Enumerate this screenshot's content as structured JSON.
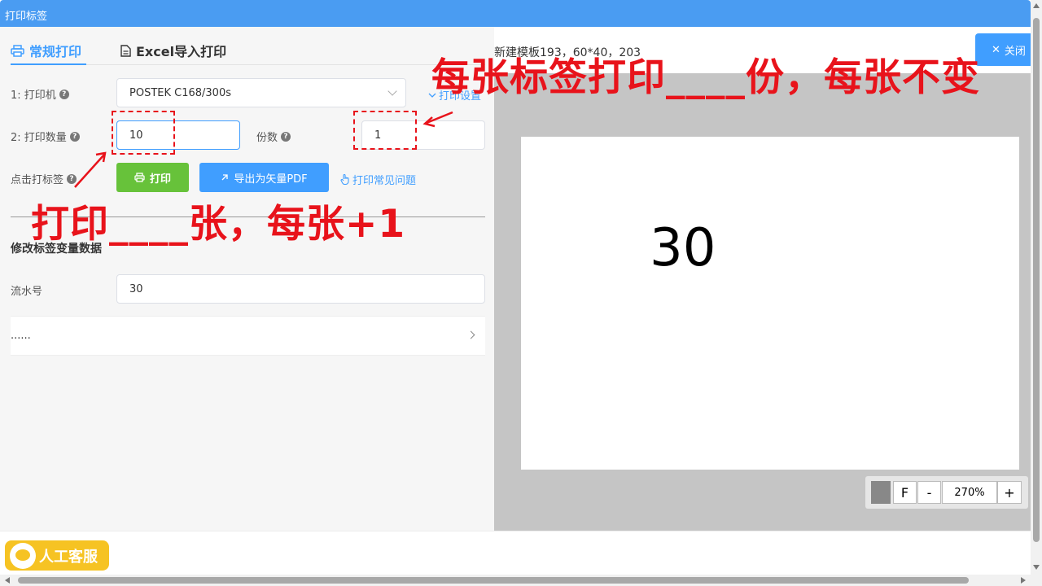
{
  "window": {
    "title": "打印标签"
  },
  "tabs": [
    {
      "label": "常规打印",
      "icon": "printer-icon",
      "active": true
    },
    {
      "label": "Excel导入打印",
      "icon": "document-icon",
      "active": false
    }
  ],
  "form": {
    "printer_label": "1: 打印机",
    "printer_value": "POSTEK C168/300s",
    "print_settings_link": "打印设置",
    "quantity_label": "2: 打印数量",
    "quantity_value": "10",
    "copies_label": "份数",
    "copies_value": "1",
    "click_print_label": "点击打标签",
    "print_button": "打印",
    "export_button": "导出为矢量PDF",
    "faq_link": "打印常见问题"
  },
  "variables": {
    "section_title": "修改标签变量数据",
    "serial_label": "流水号",
    "serial_value": "30",
    "more_label": "......"
  },
  "preview": {
    "template_name": "新建模板193，60*40，203",
    "close_button": "关闭",
    "label_text": "30",
    "zoom_f": "F",
    "zoom_minus": "-",
    "zoom_level": "270%",
    "zoom_plus": "+"
  },
  "footer": {
    "support_button": "人工客服"
  },
  "annotations": {
    "top_text": "每张标签打印____份，每张不变",
    "left_text": "打印____张，每张+1"
  },
  "colors": {
    "accent": "#409eff",
    "print_button": "#67c23a",
    "annotation": "#e8131b",
    "titlebar": "#4a9cf2",
    "support_button": "#f6c323"
  }
}
